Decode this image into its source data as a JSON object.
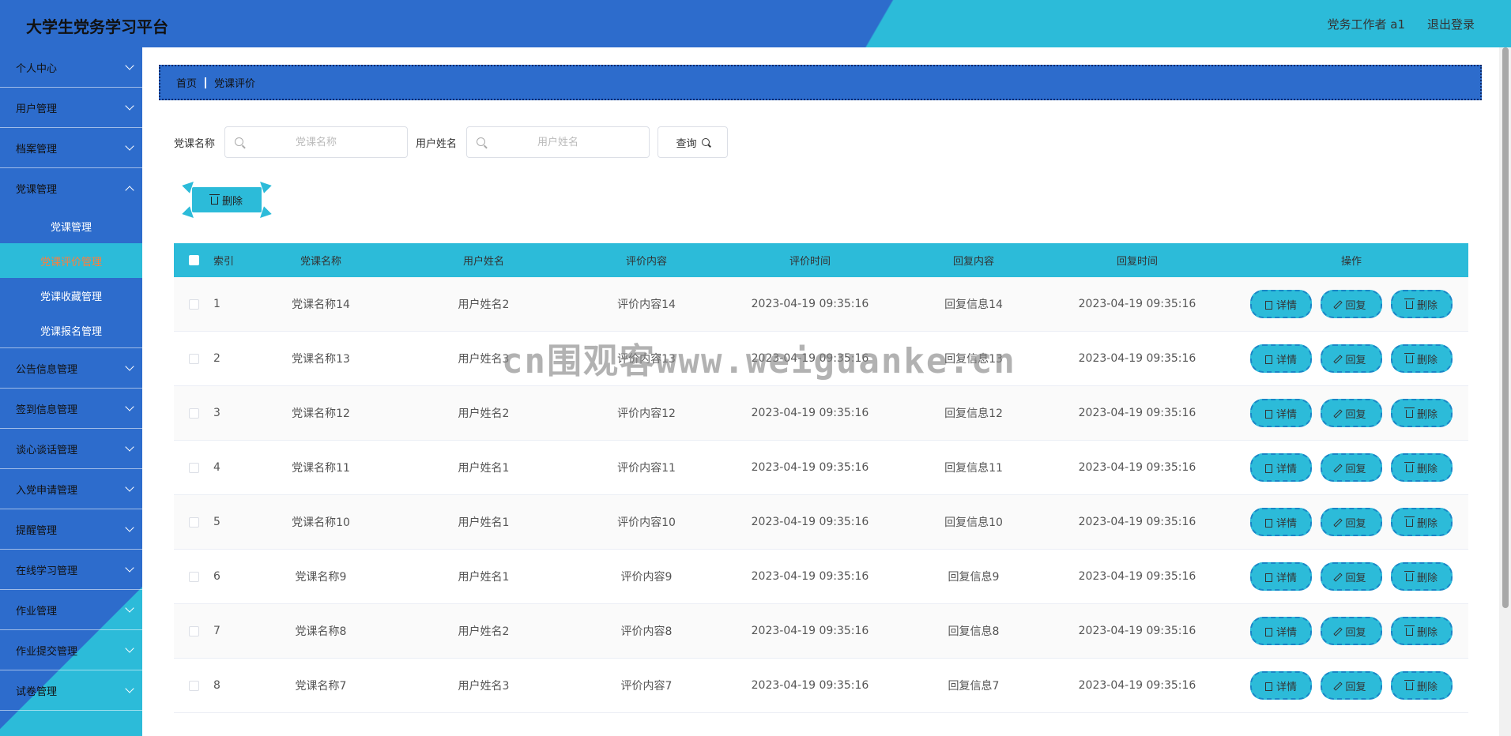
{
  "header": {
    "title": "大学生党务学习平台",
    "user": "党务工作者 a1",
    "logout": "退出登录"
  },
  "sidebar": {
    "items": [
      {
        "label": "个人中心"
      },
      {
        "label": "用户管理"
      },
      {
        "label": "档案管理"
      },
      {
        "label": "党课管理",
        "open": true,
        "children": [
          {
            "label": "党课管理"
          },
          {
            "label": "党课评价管理",
            "active": true
          },
          {
            "label": "党课收藏管理"
          },
          {
            "label": "党课报名管理"
          }
        ]
      },
      {
        "label": "公告信息管理"
      },
      {
        "label": "签到信息管理"
      },
      {
        "label": "谈心谈话管理"
      },
      {
        "label": "入党申请管理"
      },
      {
        "label": "提醒管理"
      },
      {
        "label": "在线学习管理"
      },
      {
        "label": "作业管理"
      },
      {
        "label": "作业提交管理"
      },
      {
        "label": "试卷管理"
      }
    ]
  },
  "breadcrumb": {
    "home": "首页",
    "current": "党课评价"
  },
  "search": {
    "course_label": "党课名称",
    "course_placeholder": "党课名称",
    "user_label": "用户姓名",
    "user_placeholder": "用户姓名",
    "query": "查询"
  },
  "toolbar": {
    "delete": "删除"
  },
  "table": {
    "headers": [
      "索引",
      "党课名称",
      "用户姓名",
      "评价内容",
      "评价时间",
      "回复内容",
      "回复时间",
      "操作"
    ],
    "actions": {
      "detail": "详情",
      "reply": "回复",
      "delete": "删除"
    },
    "rows": [
      {
        "index": "1",
        "course": "党课名称14",
        "user": "用户姓名2",
        "content": "评价内容14",
        "time": "2023-04-19 09:35:16",
        "reply": "回复信息14",
        "reply_time": "2023-04-19 09:35:16"
      },
      {
        "index": "2",
        "course": "党课名称13",
        "user": "用户姓名3",
        "content": "评价内容13",
        "time": "2023-04-19 09:35:16",
        "reply": "回复信息13",
        "reply_time": "2023-04-19 09:35:16"
      },
      {
        "index": "3",
        "course": "党课名称12",
        "user": "用户姓名2",
        "content": "评价内容12",
        "time": "2023-04-19 09:35:16",
        "reply": "回复信息12",
        "reply_time": "2023-04-19 09:35:16"
      },
      {
        "index": "4",
        "course": "党课名称11",
        "user": "用户姓名1",
        "content": "评价内容11",
        "time": "2023-04-19 09:35:16",
        "reply": "回复信息11",
        "reply_time": "2023-04-19 09:35:16"
      },
      {
        "index": "5",
        "course": "党课名称10",
        "user": "用户姓名1",
        "content": "评价内容10",
        "time": "2023-04-19 09:35:16",
        "reply": "回复信息10",
        "reply_time": "2023-04-19 09:35:16"
      },
      {
        "index": "6",
        "course": "党课名称9",
        "user": "用户姓名1",
        "content": "评价内容9",
        "time": "2023-04-19 09:35:16",
        "reply": "回复信息9",
        "reply_time": "2023-04-19 09:35:16"
      },
      {
        "index": "7",
        "course": "党课名称8",
        "user": "用户姓名2",
        "content": "评价内容8",
        "time": "2023-04-19 09:35:16",
        "reply": "回复信息8",
        "reply_time": "2023-04-19 09:35:16"
      },
      {
        "index": "8",
        "course": "党课名称7",
        "user": "用户姓名3",
        "content": "评价内容7",
        "time": "2023-04-19 09:35:16",
        "reply": "回复信息7",
        "reply_time": "2023-04-19 09:35:16"
      }
    ]
  },
  "watermark": "cn围观客www.weiguanke.cn",
  "colors": {
    "primary": "#2d6ccc",
    "accent": "#2cbbd9",
    "active_text": "#ff7d3b"
  }
}
